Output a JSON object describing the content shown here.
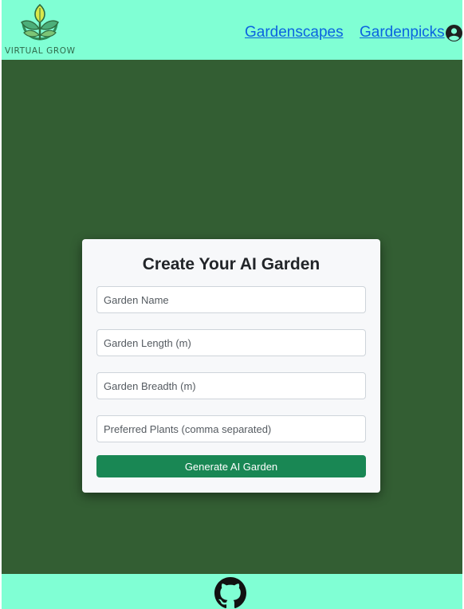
{
  "header": {
    "logo_text": "VIRTUAL GROW",
    "nav": [
      {
        "label": "Gardenscapes"
      },
      {
        "label": "Gardenpicks"
      }
    ]
  },
  "form": {
    "title": "Create Your AI Garden",
    "fields": [
      {
        "placeholder": "Garden Name",
        "value": ""
      },
      {
        "placeholder": "Garden Length (m)",
        "value": ""
      },
      {
        "placeholder": "Garden Breadth (m)",
        "value": ""
      },
      {
        "placeholder": "Preferred Plants (comma separated)",
        "value": ""
      }
    ],
    "submit_label": "Generate AI Garden"
  },
  "icons": {
    "logo": "plant-sprout-logo-icon",
    "account": "user-circle-icon",
    "footer": "github-icon"
  },
  "colors": {
    "header_bg": "#80ffd4",
    "main_bg": "#335e33",
    "link": "#0b63e0",
    "button": "#198754",
    "card_bg": "#f7f8fa"
  }
}
